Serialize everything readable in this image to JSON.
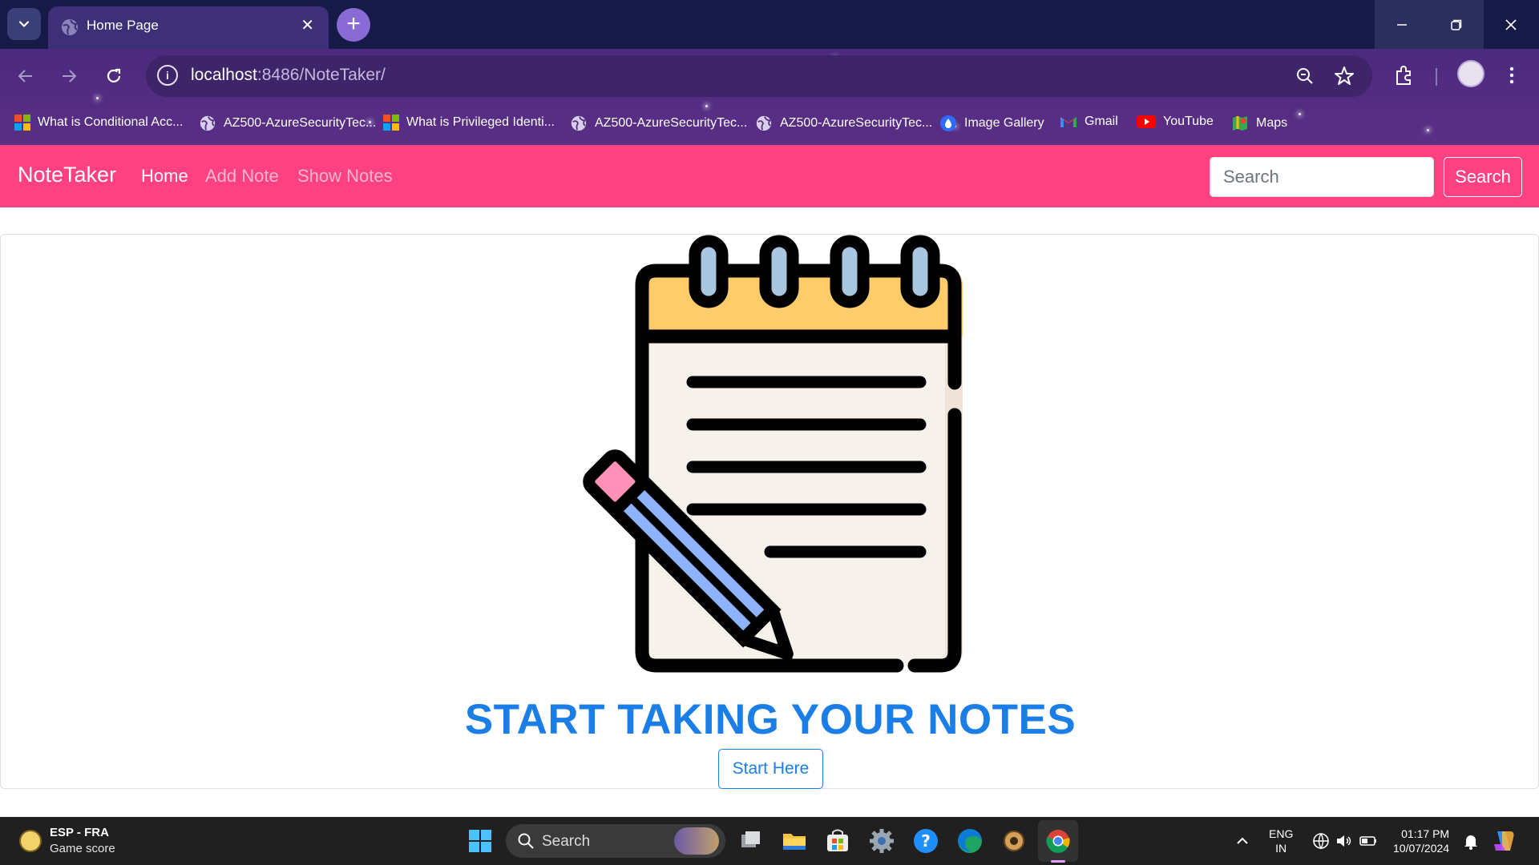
{
  "browser": {
    "tab_title": "Home Page",
    "tab_close_icon": "close-icon",
    "new_tab_label": "+",
    "url_host": "localhost",
    "url_rest": ":8486/NoteTaker/",
    "bookmarks": [
      {
        "label": "What is Conditional Acc...",
        "icon": "microsoft-logo-icon"
      },
      {
        "label": "AZ500-AzureSecurityTec...",
        "icon": "globe-icon"
      },
      {
        "label": "What is Privileged Identi...",
        "icon": "microsoft-logo-icon"
      },
      {
        "label": "AZ500-AzureSecurityTec...",
        "icon": "globe-icon"
      },
      {
        "label": "AZ500-AzureSecurityTec...",
        "icon": "globe-icon"
      },
      {
        "label": "Image Gallery",
        "icon": "drop-icon"
      },
      {
        "label": "Gmail",
        "icon": "gmail-icon"
      },
      {
        "label": "YouTube",
        "icon": "youtube-icon"
      },
      {
        "label": "Maps",
        "icon": "maps-icon"
      }
    ]
  },
  "app": {
    "brand": "NoteTaker",
    "nav": [
      "Home",
      "Add Note",
      "Show Notes"
    ],
    "search_placeholder": "Search",
    "search_button": "Search",
    "hero_title": "START TAKING YOUR NOTES",
    "start_button": "Start Here"
  },
  "taskbar": {
    "weather_title": "ESP - FRA",
    "weather_sub": "Game score",
    "search_label": "Search",
    "lang_top": "ENG",
    "lang_bottom": "IN",
    "time": "01:17 PM",
    "date": "10/07/2024"
  },
  "colors": {
    "navbar": "#ff4081",
    "primary": "#1a7ee6",
    "chrome_tabstrip": "#151a47",
    "chrome_toolbar": "#4c2a7e",
    "taskbar": "#202020"
  }
}
